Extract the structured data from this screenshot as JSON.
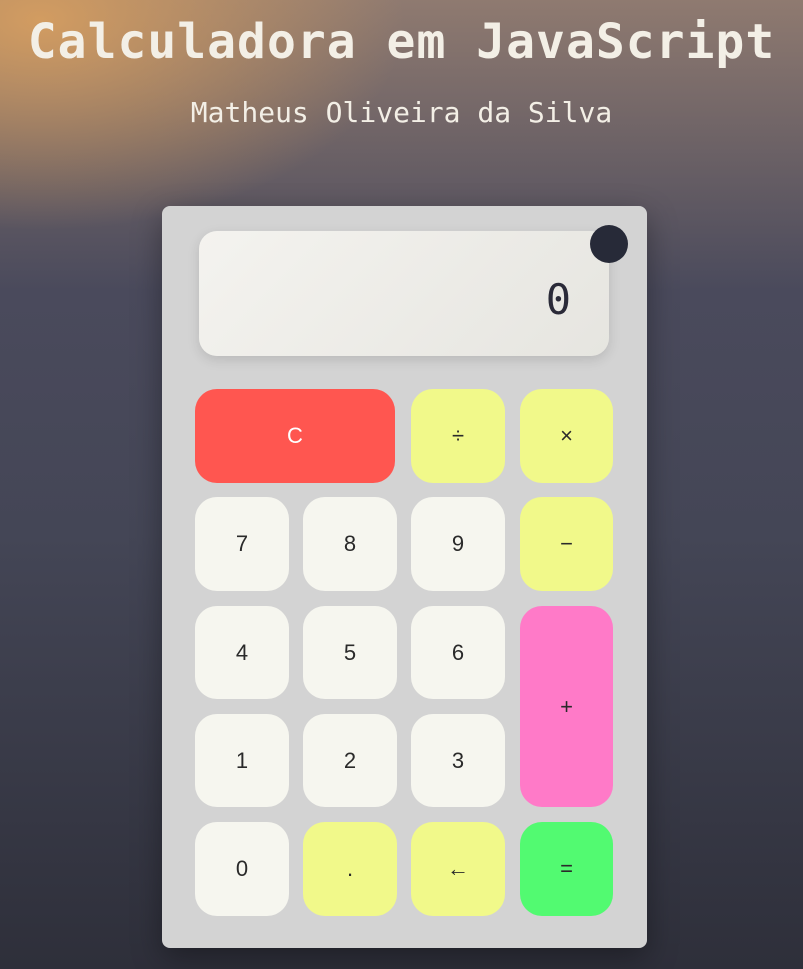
{
  "header": {
    "title": "Calculadora em JavaScript",
    "author": "Matheus Oliveira da Silva"
  },
  "display": {
    "value": "0"
  },
  "theme_toggle": {
    "color": "#272a38"
  },
  "keys": {
    "clear": "C",
    "divide": "÷",
    "multiply": "×",
    "seven": "7",
    "eight": "8",
    "nine": "9",
    "minus": "−",
    "four": "4",
    "five": "5",
    "six": "6",
    "plus": "+",
    "one": "1",
    "two": "2",
    "three": "3",
    "zero": "0",
    "decimal": ".",
    "backspace": "←",
    "equals": "="
  },
  "colors": {
    "number_key": "#f6f6ef",
    "operator_key": "#f1f98a",
    "clear_key": "#ff5650",
    "plus_key": "#ff7ac8",
    "equals_key": "#52fa71",
    "calculator_body": "#d3d3d3"
  }
}
